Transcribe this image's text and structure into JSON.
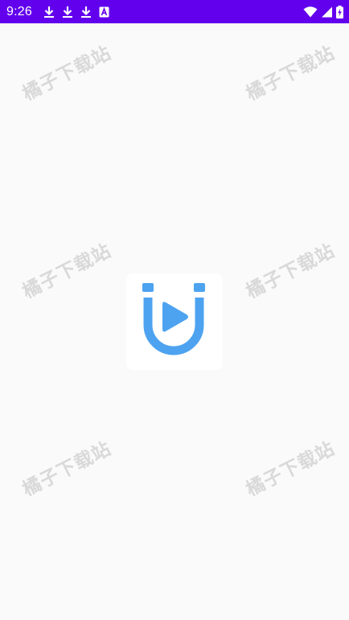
{
  "status_bar": {
    "time": "9:26",
    "background": "#6200ee",
    "left_icons": [
      "download-icon",
      "download-icon",
      "download-icon",
      "font-a-icon"
    ],
    "right_icons": [
      "wifi-icon",
      "signal-icon",
      "battery-charging-icon"
    ]
  },
  "watermark": {
    "text": "橘子下载站"
  },
  "logo": {
    "icon": "app-logo-icon",
    "accent": "#4da3f0"
  }
}
